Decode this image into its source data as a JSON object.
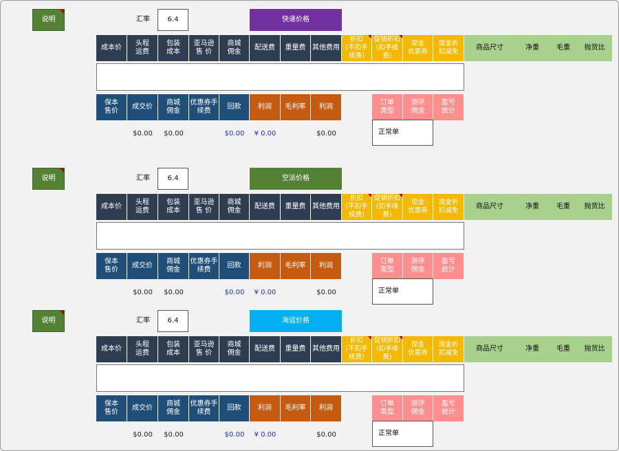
{
  "sections": [
    {
      "note_label": "说明",
      "rate_label": "汇率",
      "rate_value": "6.4",
      "title": "快递价格",
      "title_color": "#7030a0",
      "header": {
        "dark": [
          "成本价",
          "头程\n运费",
          "包装\n成本",
          "亚马逊\n售 价",
          "商城\n佣金",
          "配送费",
          "重量费",
          "其他费用"
        ],
        "yellow": [
          "折扣\n(不扣手\n续费)",
          "促销折扣\n(扣手续\n费)",
          "现金\n优惠券",
          "现金折\n扣减免"
        ],
        "green": [
          "商品尺寸",
          "净重",
          "毛重",
          "抛货比"
        ]
      },
      "row2": {
        "blue": [
          "保本\n售价",
          "成交价",
          "商城\n佣金",
          "优惠券手\n续费",
          "回款"
        ],
        "orange": [
          "利润",
          "毛利率",
          "利润"
        ],
        "pink": [
          "订单\n类型",
          "测评\n佣金",
          "盈亏\n统计"
        ]
      },
      "values": [
        "$0.00",
        "$0.00",
        "$0.00",
        "¥ 0.00",
        "$0.00"
      ],
      "order_type": "正常单"
    },
    {
      "note_label": "说明",
      "rate_label": "汇率",
      "rate_value": "6.4",
      "title": "空派价格",
      "title_color": "#548235",
      "header": {
        "dark": [
          "成本价",
          "头程\n运费",
          "包装\n成本",
          "亚马逊\n售 价",
          "商城\n佣金",
          "配送费",
          "重量费",
          "其他费用"
        ],
        "yellow": [
          "折扣\n(不扣手\n续费)",
          "促销折扣\n(扣手续\n费)",
          "现金\n优惠券",
          "现金折\n扣减免"
        ],
        "green": [
          "商品尺寸",
          "净重",
          "毛重",
          "抛货比"
        ]
      },
      "row2": {
        "blue": [
          "保本\n售价",
          "成交价",
          "商城\n佣金",
          "优惠券手\n续费",
          "回款"
        ],
        "orange": [
          "利润",
          "毛利率",
          "利润"
        ],
        "pink": [
          "订单\n类型",
          "测评\n佣金",
          "盈亏\n统计"
        ]
      },
      "values": [
        "$0.00",
        "$0.00",
        "$0.00",
        "¥ 0.00",
        "$0.00"
      ],
      "order_type": "正常单"
    },
    {
      "note_label": "说明",
      "rate_label": "汇率",
      "rate_value": "6.4",
      "title": "海运价格",
      "title_color": "#00b0f0",
      "header": {
        "dark": [
          "成本价",
          "头程\n运费",
          "包装\n成本",
          "亚马逊\n售 价",
          "商城\n佣金",
          "配送费",
          "重量费",
          "其他费用"
        ],
        "yellow": [
          "折扣\n(不扣手\n续费)",
          "促销折扣\n(扣手续\n费)",
          "现金\n优惠券",
          "现金折\n扣减免"
        ],
        "green": [
          "商品尺寸",
          "净重",
          "毛重",
          "抛货比"
        ]
      },
      "row2": {
        "blue": [
          "保本\n售价",
          "成交价",
          "商城\n佣金",
          "优惠券手\n续费",
          "回款"
        ],
        "orange": [
          "利润",
          "毛利率",
          "利润"
        ],
        "pink": [
          "订单\n类型",
          "测评\n佣金",
          "盈亏\n统计"
        ]
      },
      "values": [
        "$0.00",
        "$0.00",
        "$0.00",
        "¥ 0.00",
        "$0.00"
      ],
      "order_type": "正常单"
    }
  ]
}
